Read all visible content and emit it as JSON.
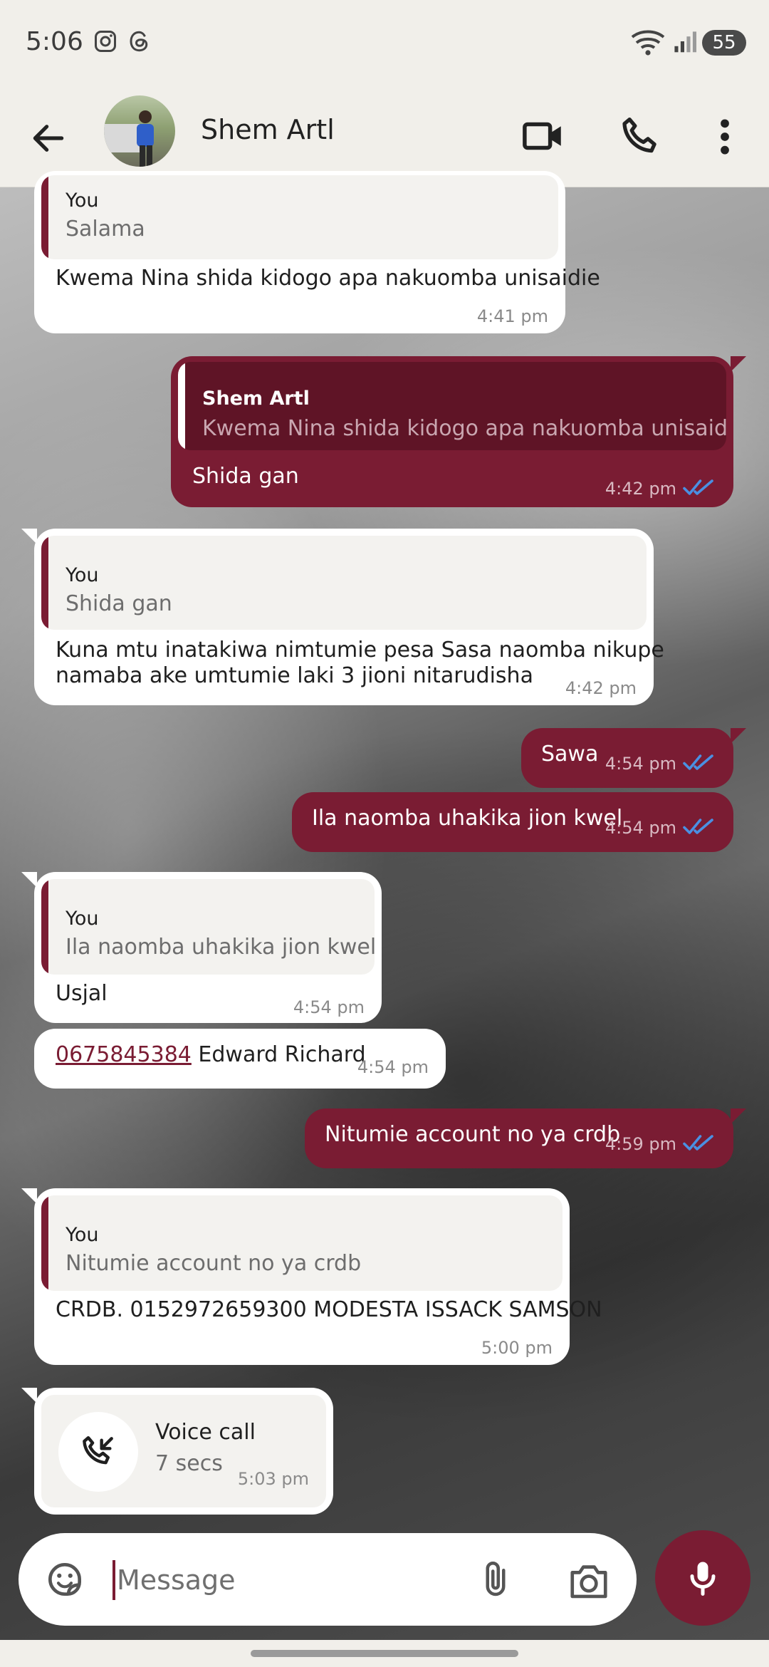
{
  "status": {
    "time": "5:06",
    "battery": "55"
  },
  "header": {
    "contact_name": "Shem Artl"
  },
  "messages": [
    {
      "author": "You",
      "quoted": "Salama",
      "text": "Kwema Nina shida kidogo apa nakuomba unisaidie",
      "time": "4:41 pm"
    },
    {
      "author": "Shem Artl",
      "quoted": "Kwema Nina shida kidogo apa nakuomba unisaidie",
      "text": "Shida gan",
      "time": "4:42 pm"
    },
    {
      "author": "You",
      "quoted": "Shida gan",
      "text_line1": "Kuna mtu inatakiwa nimtumie pesa Sasa naomba nikupe",
      "text_line2": "namaba ake umtumie laki 3 jioni nitarudisha",
      "time": "4:42 pm"
    },
    {
      "text": "Sawa",
      "time": "4:54 pm"
    },
    {
      "text": "Ila naomba uhakika jion kwel",
      "time": "4:54 pm"
    },
    {
      "author": "You",
      "quoted": "Ila naomba uhakika jion kwel",
      "text": "Usjal",
      "time": "4:54 pm"
    },
    {
      "phone": "0675845384",
      "text": " Edward Richard",
      "time": "4:54 pm"
    },
    {
      "text": "Nitumie account no ya crdb",
      "time": "4:59 pm"
    },
    {
      "author": "You",
      "quoted": "Nitumie account no ya crdb",
      "text": "CRDB. 0152972659300 MODESTA ISSACK SAMSON",
      "time": "5:00 pm"
    }
  ],
  "call": {
    "label": "Voice call",
    "duration": "7 secs",
    "time": "5:03 pm"
  },
  "input": {
    "placeholder": "Message"
  },
  "colors": {
    "accent": "#7a1c33",
    "read_ticks": "#4a90e2",
    "background": "#f1efea"
  }
}
